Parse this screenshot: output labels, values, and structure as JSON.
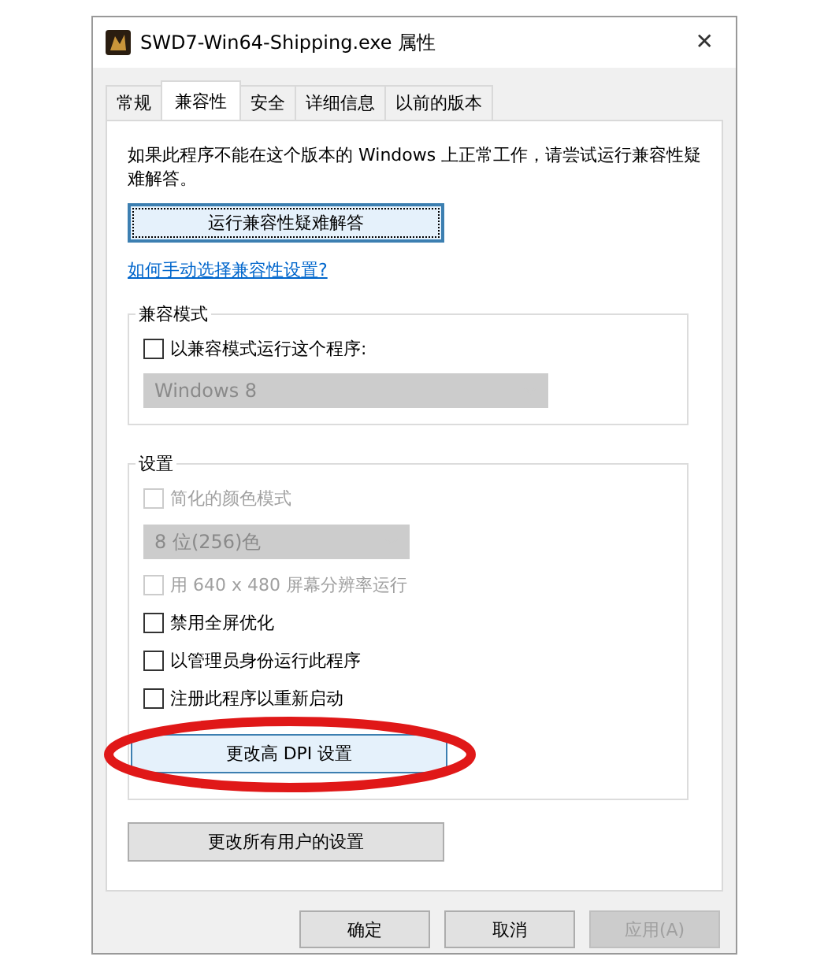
{
  "window": {
    "title": "SWD7-Win64-Shipping.exe 属性",
    "close": "✕"
  },
  "tabs": [
    {
      "label": "常规",
      "selected": false
    },
    {
      "label": "兼容性",
      "selected": true
    },
    {
      "label": "安全",
      "selected": false
    },
    {
      "label": "详细信息",
      "selected": false
    },
    {
      "label": "以前的版本",
      "selected": false
    }
  ],
  "intro": "如果此程序不能在这个版本的 Windows 上正常工作，请尝试运行兼容性疑难解答。",
  "troubleshoot_button": "运行兼容性疑难解答",
  "manual_link": "如何手动选择兼容性设置?",
  "compat_mode": {
    "title": "兼容模式",
    "items": [
      {
        "kind": "checkbox",
        "label": "以兼容模式运行这个程序:",
        "checked": false,
        "disabled": false
      },
      {
        "kind": "dropdown",
        "value": "Windows 8",
        "disabled": true
      }
    ]
  },
  "settings": {
    "title": "设置",
    "items": [
      {
        "kind": "checkbox",
        "label": "简化的颜色模式",
        "checked": false,
        "disabled": true
      },
      {
        "kind": "dropdown",
        "value": "8 位(256)色",
        "disabled": true
      },
      {
        "kind": "checkbox",
        "label": "用 640 x 480 屏幕分辨率运行",
        "checked": false,
        "disabled": true
      },
      {
        "kind": "checkbox",
        "label": "禁用全屏优化",
        "checked": false,
        "disabled": false
      },
      {
        "kind": "checkbox",
        "label": "以管理员身份运行此程序",
        "checked": false,
        "disabled": false
      },
      {
        "kind": "checkbox",
        "label": "注册此程序以重新启动",
        "checked": false,
        "disabled": false
      },
      {
        "kind": "button",
        "label": "更改高 DPI 设置",
        "circled": true
      }
    ]
  },
  "all_users_button": "更改所有用户的设置",
  "buttons": [
    {
      "label": "确定",
      "disabled": false
    },
    {
      "label": "取消",
      "disabled": false
    },
    {
      "label": "应用(A)",
      "disabled": true
    }
  ]
}
